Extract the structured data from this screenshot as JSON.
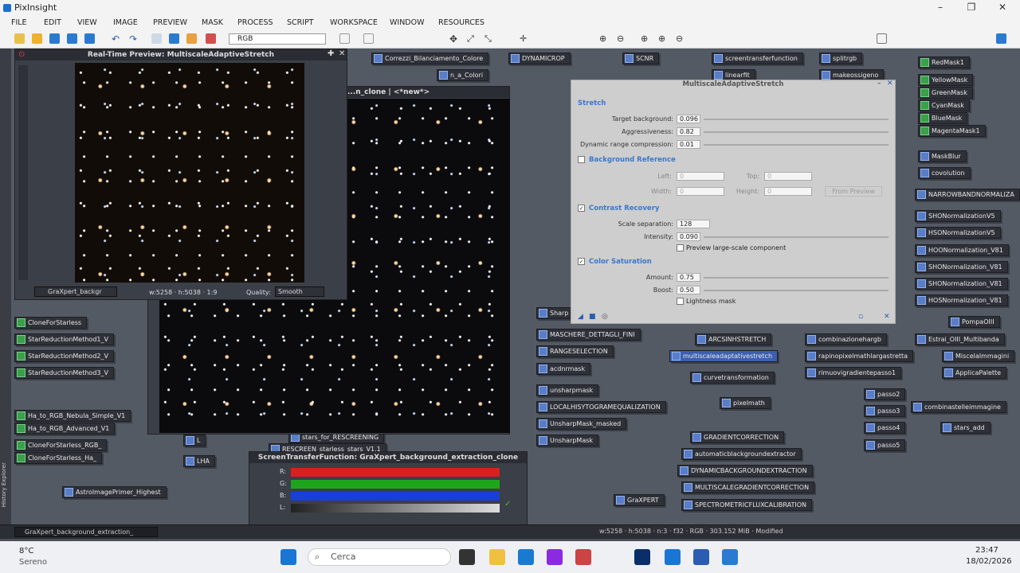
{
  "app": {
    "title": "PixInsight"
  },
  "menu": [
    "FILE",
    "EDIT",
    "VIEW",
    "IMAGE",
    "PREVIEW",
    "MASK",
    "PROCESS",
    "SCRIPT",
    "WORKSPACE",
    "WINDOW",
    "RESOURCES"
  ],
  "toolbar": {
    "color_mode": "RGB"
  },
  "preview": {
    "title": "Real-Time Preview: MultiscaleAdaptiveStretch",
    "view_select": "GraXpert_backgr",
    "info": "w:5258 · h:5038 · 1:9",
    "quality_label": "Quality:",
    "quality_value": "Smooth"
  },
  "image_window": {
    "title": "...n_clone | <*new*>"
  },
  "mas": {
    "title": "MultiscaleAdaptiveStretch",
    "stretch": {
      "label": "Stretch",
      "target_bg_label": "Target background:",
      "target_bg": "0.096",
      "aggressiveness_label": "Aggressiveness:",
      "aggressiveness": "0.82",
      "drc_label": "Dynamic range compression:",
      "drc": "0.01"
    },
    "bgref": {
      "label": "Background Reference",
      "left_label": "Left:",
      "left": "0",
      "top_label": "Top:",
      "top": "0",
      "width_label": "Width:",
      "width": "0",
      "height_label": "Height:",
      "height": "0",
      "from_preview": "From Preview"
    },
    "contrast": {
      "label": "Contrast Recovery",
      "scale_label": "Scale separation:",
      "scale": "128",
      "intensity_label": "Intensity:",
      "intensity": "0.090",
      "preview_ls": "Preview large-scale component"
    },
    "color": {
      "label": "Color Saturation",
      "amount_label": "Amount:",
      "amount": "0.75",
      "boost_label": "Boost:",
      "boost": "0.50",
      "lightness": "Lightness mask"
    }
  },
  "stf": {
    "title": "ScreenTransferFunction: GraXpert_background_extraction_clone"
  },
  "icons_left": [
    "CloneForStarless",
    "StarReductionMethod1_V",
    "StarReductionMethod2_V",
    "StarReductionMethod3_V",
    "Ha_to_RGB_Nebula_Simple_V1",
    "Ha_to_RGB_Advanced_V1",
    "CloneForStarless_RGB_",
    "CloneForStarless_Ha_",
    "AstroImagePrimer_Highest",
    "LHA",
    "L"
  ],
  "icons_top": [
    "Correzzi_Bilanciamento_Colore",
    "DYNAMICROP",
    "SCNR",
    "screentransferfunction",
    "splitrgb",
    "linearfit",
    "makeossigeno",
    "n_a_Colori"
  ],
  "icons_mid": [
    "MASCHERE_DETTAGLI_FINI",
    "RANGESELECTION",
    "acdnrmask",
    "unsharpmask",
    "LOCALHISYTOGRAMEQUALIZATION",
    "UnsharpMask_masked",
    "UnsharpMask",
    "Sharp",
    "ARCSINHSTRETCH",
    "multiscaleadaptativestretch",
    "curvetransformation",
    "pixelmath",
    "GRADIENTCORRECTION",
    "automaticblackgroundextractor",
    "DYNAMICBACKGROUNDEXTRACTION",
    "MULTISCALEGRADIENTCORRECTION",
    "SPECTROMETRICFLUXCALIBRATION",
    "GraXPERT",
    "combinazionehargb",
    "rapinopixelmathlargastretta",
    "rimuovigradientepasso1",
    "passo2",
    "passo3",
    "passo4",
    "passo5",
    "PompaOIII",
    "Estrai_OIII_Multibanda",
    "MiscelaImmagini",
    "ApplicaPalette",
    "combinastelleimmagine",
    "stars_add",
    "stars_for_RESCREENING",
    "RESCREEN_starless_stars_V1.1"
  ],
  "icons_right": [
    "RedMask1",
    "YellowMask",
    "GreenMask",
    "CyanMask",
    "BlueMask",
    "MagentaMask1",
    "MaskBlur",
    "covolution",
    "NARROWBANDNORMALIZA",
    "SHONormalizationV5",
    "HSONormalizationV5",
    "HOONormalization_V81",
    "SHONormalization_V81",
    "SHONormalization_V81",
    "HOSNormalization_V81"
  ],
  "side_label": "History Explorer",
  "statusbar": {
    "view": "GraXpert_background_extraction_",
    "info": "w:5258 · h:5038 · n:3 · f32 · RGB · 303.152 MiB · Modified"
  },
  "taskbar": {
    "temp": "8°C",
    "weather": "Sereno",
    "search": "Cerca",
    "time": "23:47",
    "date": "18/02/2026"
  }
}
